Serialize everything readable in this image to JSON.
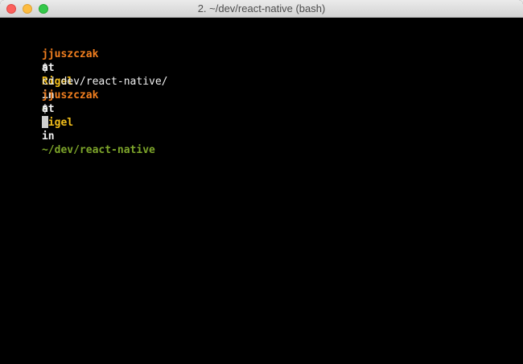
{
  "window": {
    "title": "2. ~/dev/react-native (bash)"
  },
  "terminal": {
    "blocks": [
      {
        "prompt": {
          "user": "jjuszczak",
          "at": "at",
          "host": "Rigel",
          "in": "in",
          "path": "~"
        },
        "command_line": {
          "symbol": "$",
          "command": "cd dev/react-native/"
        }
      },
      {
        "prompt": {
          "user": "jjuszczak",
          "at": "at",
          "host": "Rigel",
          "in": "in",
          "path": "~/dev/react-native"
        },
        "command_line": {
          "symbol": "$",
          "command": ""
        }
      }
    ]
  },
  "colors": {
    "background": "#000000",
    "user": "#f27f1f",
    "host": "#f1bd1a",
    "path": "#7da52a",
    "text": "#f0f0f0"
  }
}
